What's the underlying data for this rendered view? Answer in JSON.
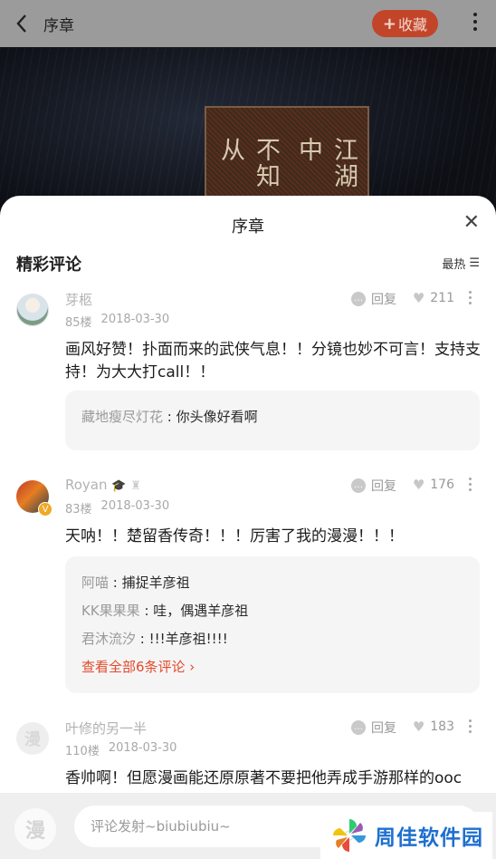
{
  "header": {
    "back_icon": "back-arrow-icon",
    "title": "序章",
    "favorite_label": "收藏",
    "favorite_plus": "+",
    "more_icon": "more-vert-icon"
  },
  "cover": {
    "text_col1": "不知从",
    "text_col2": "江湖中"
  },
  "sheet": {
    "title": "序章",
    "close_icon": "close-icon",
    "section_title": "精彩评论",
    "sort_label": "最热",
    "sort_icon": "sort-icon",
    "reply_label": "回复",
    "comments": [
      {
        "name": "芽柩",
        "floor": "85楼",
        "date": "2018-03-30",
        "likes": "211",
        "content": "画风好赞！扑面而来的武侠气息！！分镜也妙不可言！支持支持！为大大打call！！",
        "replies": [
          {
            "name": "藏地瘦尽灯花",
            "sep": " : ",
            "text": "你头像好看啊"
          }
        ]
      },
      {
        "name": "Royan",
        "floor": "83楼",
        "date": "2018-03-30",
        "likes": "176",
        "content": "天呐！！楚留香传奇！！！厉害了我的漫漫！！！",
        "replies": [
          {
            "name": "阿喵",
            "sep": " : ",
            "text": "捕捉羊彦祖"
          },
          {
            "name": "KK果果果",
            "sep": " : ",
            "text": "哇，偶遇羊彦祖"
          },
          {
            "name": "君沐流汐",
            "sep": " : ",
            "text": "!!!羊彦祖!!!!"
          }
        ],
        "view_all": "查看全部6条评论 ›"
      },
      {
        "name": "叶修的另一半",
        "floor": "110楼",
        "date": "2018-03-30",
        "likes": "183",
        "content": "香帅啊！但愿漫画能还原原著不要把他弄成手游那样的ooc",
        "avatar_char": "漫"
      }
    ]
  },
  "bottom": {
    "avatar_char": "漫",
    "input_placeholder": "评论发射~biubiubiu~"
  },
  "watermark": {
    "text": "周佳软件园"
  },
  "colors": {
    "accent": "#e24a2c",
    "fav_button": "#c2452a",
    "watermark_text": "#1d6fd0"
  }
}
